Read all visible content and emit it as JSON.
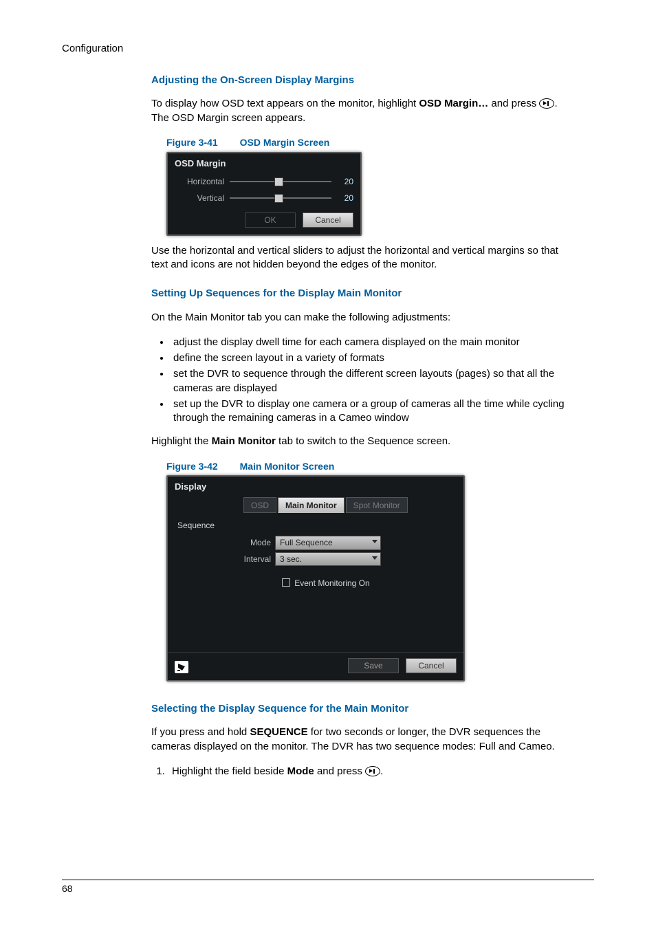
{
  "page": {
    "header": "Configuration",
    "page_number": "68"
  },
  "section1": {
    "title": "Adjusting the On-Screen Display Margins",
    "intro_before_bold": "To display how OSD text appears on the monitor, highlight ",
    "intro_bold": "OSD Margin…",
    "intro_after_bold": " and press ",
    "intro_tail": ". The OSD Margin screen appears.",
    "fig_num": "Figure 3-41",
    "fig_caption": "OSD Margin Screen",
    "osd": {
      "title": "OSD Margin",
      "horiz_label": "Horizontal",
      "horiz_val": "20",
      "vert_label": "Vertical",
      "vert_val": "20",
      "ok": "OK",
      "cancel": "Cancel"
    },
    "after_fig": "Use the horizontal and vertical sliders to adjust the horizontal and vertical margins so that text and icons are not hidden beyond the edges of the monitor."
  },
  "section2": {
    "title": "Setting Up Sequences for the Display Main Monitor",
    "intro": "On the Main Monitor tab you can make the following adjustments:",
    "bullets": [
      "adjust the display dwell time for each camera displayed on the main monitor",
      "define the screen layout in a variety of formats",
      "set the DVR to sequence through the different screen layouts (pages) so that all the cameras are displayed",
      "set up the DVR to display one camera or a group of cameras all the time while cycling through the remaining cameras in a Cameo window"
    ],
    "hl_before": "Highlight the ",
    "hl_bold": "Main Monitor",
    "hl_after": " tab to switch to the Sequence screen.",
    "fig_num": "Figure 3-42",
    "fig_caption": "Main Monitor Screen",
    "mm": {
      "title": "Display",
      "tab_osd": "OSD",
      "tab_main": "Main Monitor",
      "tab_spot": "Spot Monitor",
      "seq_label": "Sequence",
      "mode_label": "Mode",
      "mode_value": "Full Sequence",
      "interval_label": "Interval",
      "interval_value": "3 sec.",
      "event_label": "Event Monitoring On",
      "save": "Save",
      "cancel": "Cancel"
    }
  },
  "section3": {
    "title": "Selecting the Display Sequence for the Main Monitor",
    "intro_before": "If you press and hold ",
    "intro_bold": "SEQUENCE",
    "intro_after": " for two seconds or longer, the DVR sequences the cameras displayed on the monitor. The DVR has two sequence modes: Full and Cameo.",
    "step1_before": "Highlight the field beside ",
    "step1_bold": "Mode",
    "step1_after": " and press ",
    "step1_tail": "."
  }
}
